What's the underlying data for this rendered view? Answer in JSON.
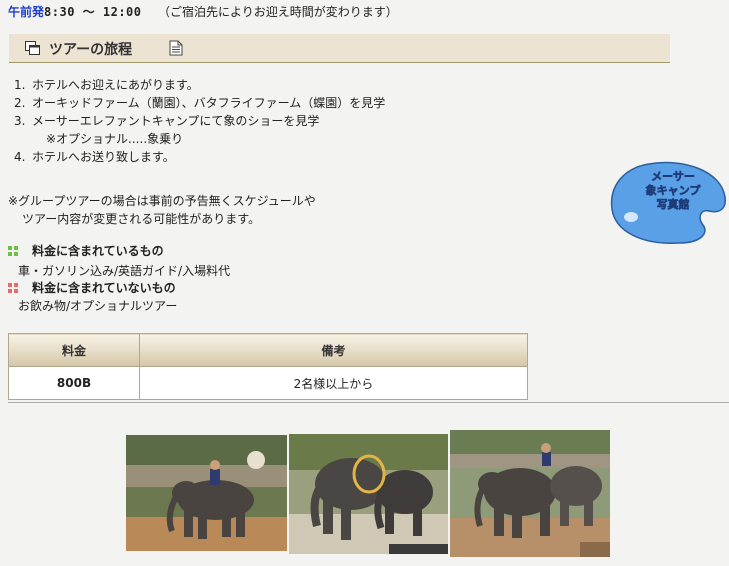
{
  "departure": {
    "am_label": "午前発",
    "time_range": "8:30 〜 12:00",
    "note": "（ご宿泊先によりお迎え時間が変わります）"
  },
  "itinerary": {
    "title": "ツアーの旅程",
    "items": [
      {
        "num": "1.",
        "text": "ホテルへお迎えにあがります。"
      },
      {
        "num": "2.",
        "text": "オーキッドファーム（蘭園）、バタフライファーム（蝶園）を見学"
      },
      {
        "num": "3.",
        "text": "メーサーエレファントキャンプにて象のショーを見学"
      },
      {
        "num": "",
        "text": "※オプショナル.....象乗り"
      },
      {
        "num": "4.",
        "text": "ホテルへお送り致します。"
      }
    ]
  },
  "group_note": {
    "line1": "※グループツアーの場合は事前の予告無くスケジュールや",
    "line2": "ツアー内容が変更される可能性があります。"
  },
  "included": {
    "title": "料金に含まれているもの",
    "body": "車・ガソリン込み/英語ガイド/入場料代",
    "icon_color": "#6fbf44"
  },
  "excluded": {
    "title": "料金に含まれていないもの",
    "body": "お飲み物/オプショナルツアー",
    "icon_color": "#e56a6a"
  },
  "price_table": {
    "headers": [
      "料金",
      "備考"
    ],
    "rows": [
      {
        "price": "800B",
        "remarks": "2名様以上から"
      }
    ]
  },
  "gallery_badge": {
    "line1": "メーサー",
    "line2": "象キャンプ",
    "line3": "写真館",
    "color": "#5aa0e6"
  },
  "photos": [
    "elephant-riding-photo",
    "elephant-hoop-photo",
    "elephant-group-photo"
  ]
}
